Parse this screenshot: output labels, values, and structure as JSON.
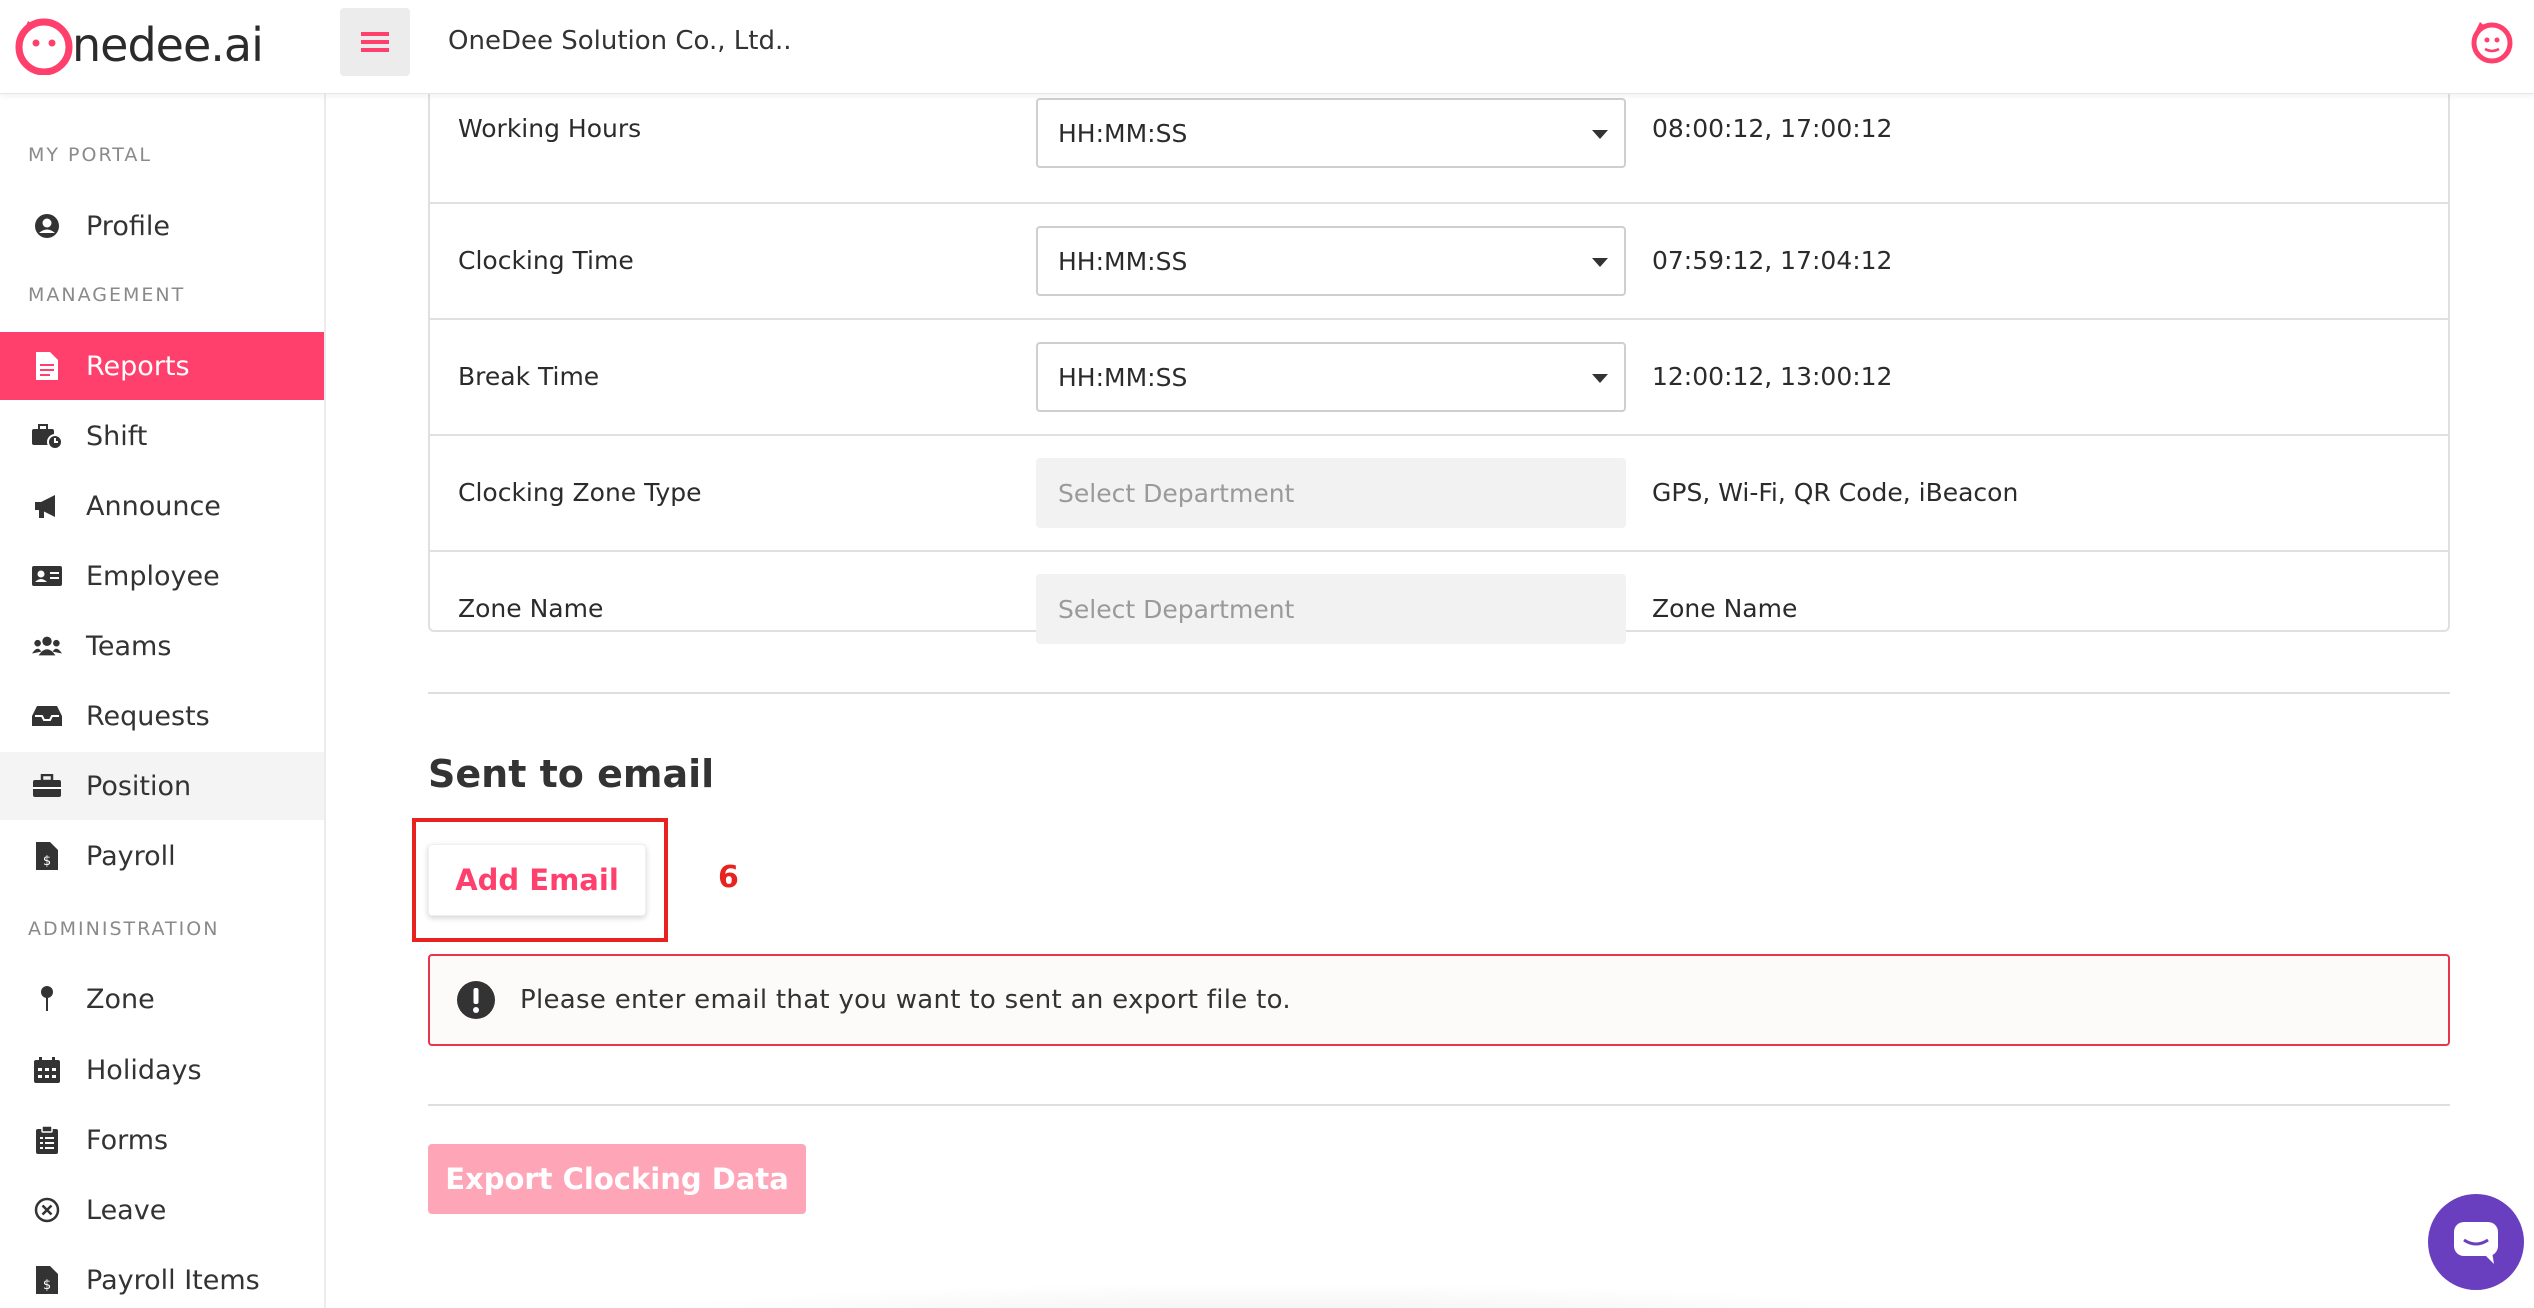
{
  "brand": {
    "logo_text": "nedee.ai",
    "accent": "#ff3f6c"
  },
  "header": {
    "company": "OneDee Solution Co., Ltd.."
  },
  "sidebar": {
    "sections": [
      {
        "title": "MY PORTAL"
      },
      {
        "title": "MANAGEMENT"
      },
      {
        "title": "ADMINISTRATION"
      }
    ],
    "items": [
      {
        "label": "Profile",
        "icon": "user-circle-icon"
      },
      {
        "label": "Reports",
        "icon": "file-icon",
        "active": true
      },
      {
        "label": "Shift",
        "icon": "briefcase-clock-icon"
      },
      {
        "label": "Announce",
        "icon": "megaphone-icon"
      },
      {
        "label": "Employee",
        "icon": "id-card-icon"
      },
      {
        "label": "Teams",
        "icon": "users-icon"
      },
      {
        "label": "Requests",
        "icon": "inbox-icon"
      },
      {
        "label": "Position",
        "icon": "briefcase-icon"
      },
      {
        "label": "Payroll",
        "icon": "file-dollar-icon"
      },
      {
        "label": "Zone",
        "icon": "pin-icon"
      },
      {
        "label": "Holidays",
        "icon": "calendar-icon"
      },
      {
        "label": "Forms",
        "icon": "clipboard-icon"
      },
      {
        "label": "Leave",
        "icon": "x-circle-icon"
      },
      {
        "label": "Payroll Items",
        "icon": "file-dollar-icon"
      }
    ]
  },
  "table": {
    "rows": [
      {
        "label": "Working Hours",
        "select": "HH:MM:SS",
        "value": "08:00:12, 17:00:12"
      },
      {
        "label": "Clocking Time",
        "select": "HH:MM:SS",
        "value": "07:59:12, 17:04:12"
      },
      {
        "label": "Break Time",
        "select": "HH:MM:SS",
        "value": "12:00:12, 13:00:12"
      },
      {
        "label": "Clocking Zone Type",
        "placeholder": "Select Department",
        "value": "GPS, Wi-Fi, QR Code, iBeacon"
      },
      {
        "label": "Zone Name",
        "placeholder": "Select Department",
        "value": "Zone Name"
      }
    ]
  },
  "email_section": {
    "title": "Sent to email",
    "add_button": "Add Email",
    "step_marker": "6",
    "alert": "Please enter email that you want to sent an export file to."
  },
  "export_button": "Export Clocking Data"
}
